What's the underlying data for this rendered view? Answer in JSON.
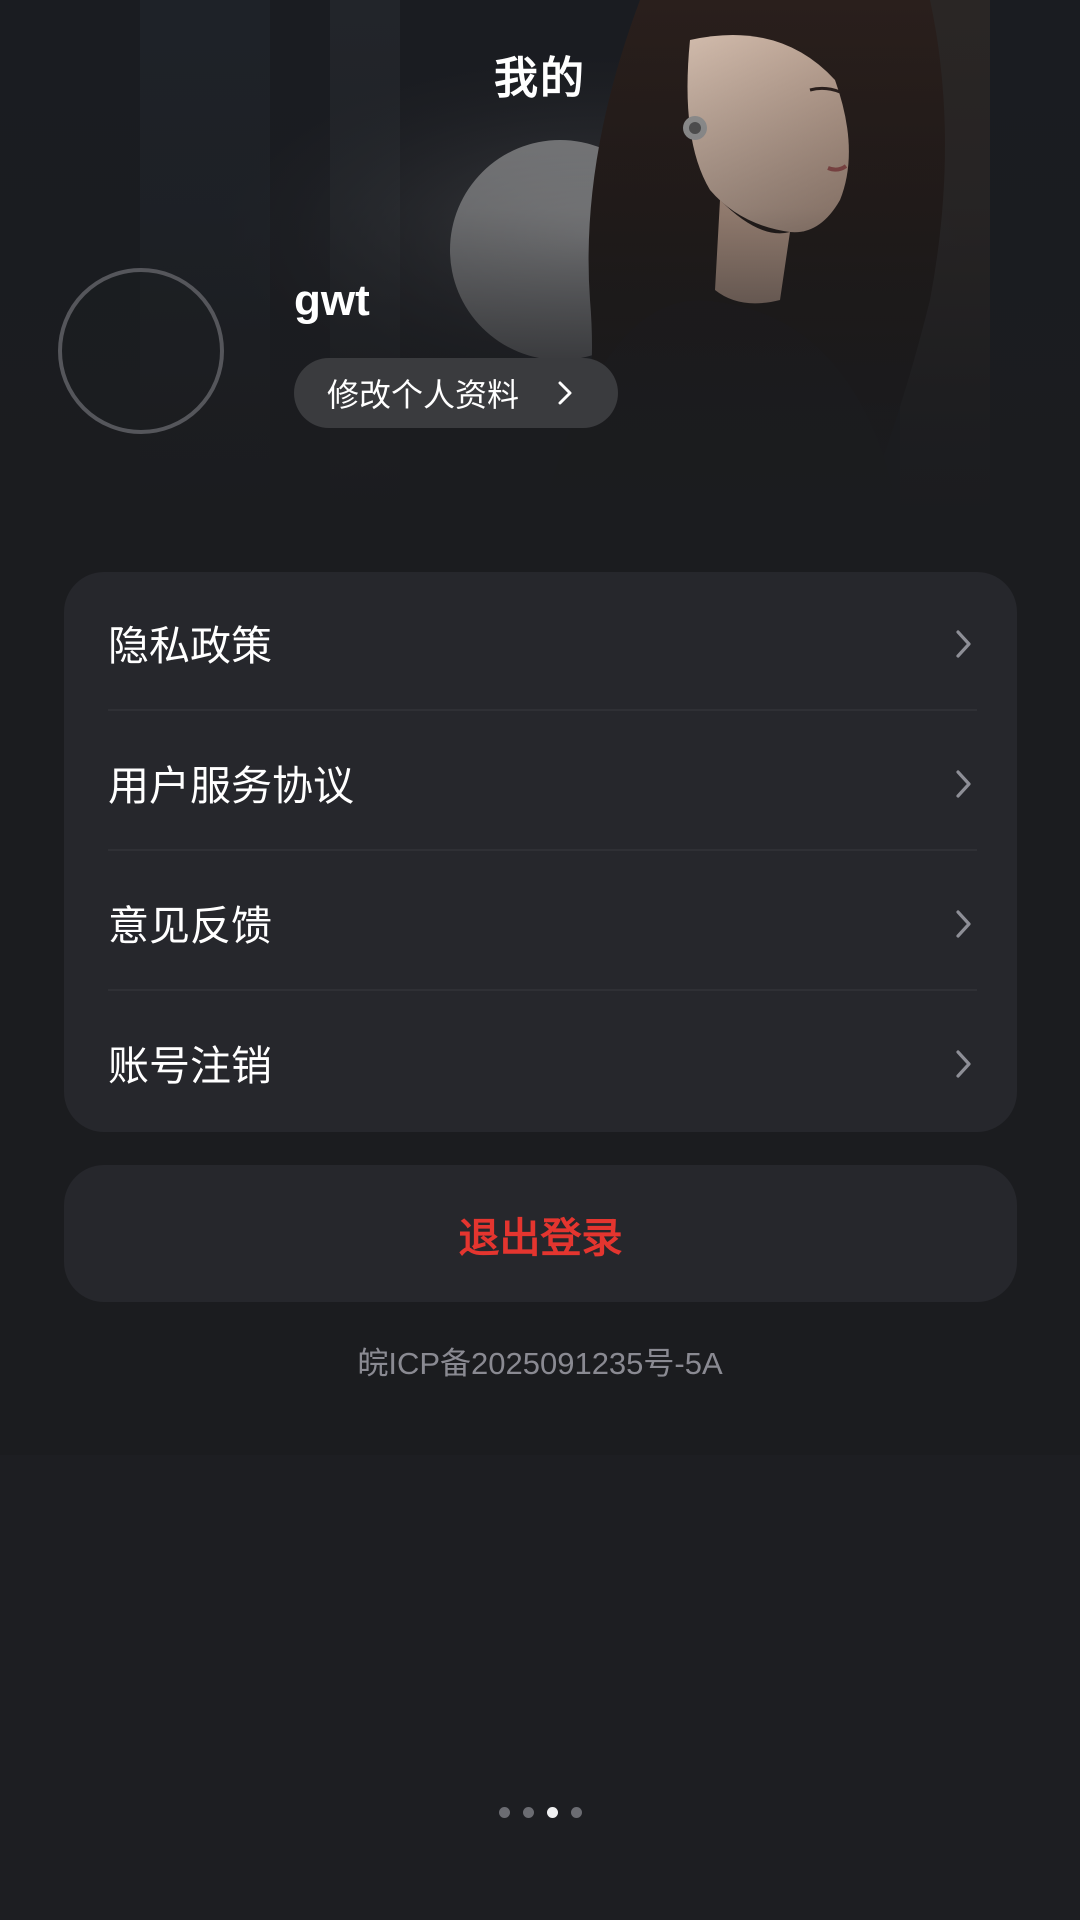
{
  "header": {
    "title": "我的"
  },
  "profile": {
    "username": "gwt",
    "edit_label": "修改个人资料"
  },
  "menu": {
    "items": [
      {
        "label": "隐私政策",
        "name": "privacy-policy"
      },
      {
        "label": "用户服务协议",
        "name": "user-agreement"
      },
      {
        "label": "意见反馈",
        "name": "feedback"
      },
      {
        "label": "账号注销",
        "name": "account-deletion"
      }
    ]
  },
  "logout": {
    "label": "退出登录"
  },
  "footer": {
    "icp": "皖ICP备2025091235号-5A"
  },
  "pager": {
    "count": 4,
    "active_index": 2
  },
  "colors": {
    "accent_red": "#e4352f",
    "card_bg": "#26272c",
    "page_bg": "#1d1e22"
  }
}
